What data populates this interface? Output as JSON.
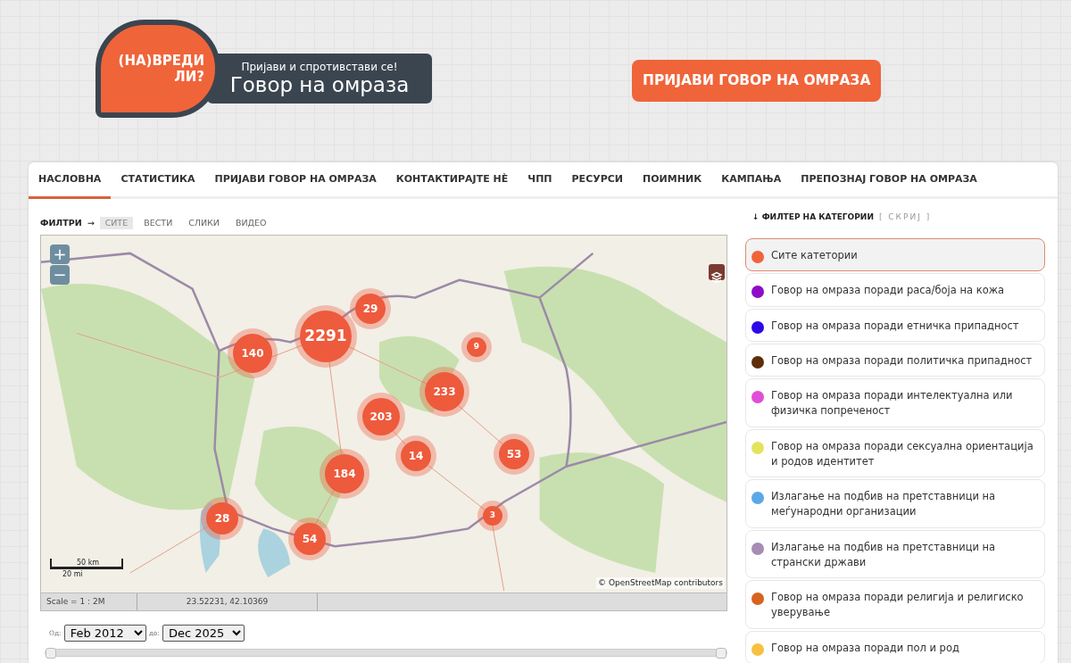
{
  "logo": {
    "line_1": "(НА)ВРЕДИ",
    "line_2": "ЛИ?",
    "tagline": "Пријави и спротивстави се!",
    "title": "Говор на омраза"
  },
  "report_button": "ПРИЈАВИ ГОВОР НА ОМРАЗА",
  "nav": [
    {
      "label": "НАСЛОВНА",
      "selected": true
    },
    {
      "label": "СТАТИСТИКА",
      "selected": false
    },
    {
      "label": "ПРИЈАВИ ГОВОР НА ОМРАЗА",
      "selected": false
    },
    {
      "label": "КОНТАКТИРАЈТЕ НÈ",
      "selected": false
    },
    {
      "label": "ЧПП",
      "selected": false
    },
    {
      "label": "РЕСУРСИ",
      "selected": false
    },
    {
      "label": "ПОИМНИК",
      "selected": false
    },
    {
      "label": "КАМПАЊА",
      "selected": false
    },
    {
      "label": "ПРЕПОЗНАЈ ГОВОР НА ОМРАЗА",
      "selected": false
    }
  ],
  "filters": {
    "label": "ФИЛТРИ",
    "arrow": "→",
    "items": [
      {
        "label": "СИТЕ",
        "selected": true
      },
      {
        "label": "ВЕСТИ",
        "selected": false
      },
      {
        "label": "СЛИКИ",
        "selected": false
      },
      {
        "label": "ВИДЕО",
        "selected": false
      }
    ]
  },
  "map": {
    "zoom_in": "+",
    "zoom_out": "−",
    "clusters": [
      "2291",
      "29",
      "140",
      "9",
      "233",
      "203",
      "14",
      "53",
      "184",
      "28",
      "54",
      "3"
    ],
    "scale_km": "50 km",
    "scale_mi": "20 mi",
    "attribution_prefix": "©",
    "attribution_link": "OpenStreetMap contributors",
    "status_scale": "Scale = 1 : 2M",
    "status_coords": "23.52231, 42.10369"
  },
  "date_range": {
    "from_label": "Од:",
    "from_value": "Feb 2012",
    "to_label": "до:",
    "to_value": "Dec 2025",
    "handles": [
      {
        "level": 0
      },
      {
        "level": 1
      }
    ]
  },
  "category_filter": {
    "arrow": "↓",
    "title": "ФИЛТЕР НА КАТЕГОРИИ",
    "toggle": "[ СКРИЈ ]",
    "items": [
      {
        "label": "Сите катетории",
        "color": "#f0643a",
        "selected": true
      },
      {
        "label": "Говор на омраза поради раса/боја на кожа",
        "color": "#8e0cc8",
        "selected": false
      },
      {
        "label": "Говор на омраза поради етничка припадност",
        "color": "#2e09e8",
        "selected": false
      },
      {
        "label": "Говор на омраза поради политичка припадност",
        "color": "#5e2e0a",
        "selected": false
      },
      {
        "label": "Говор на омраза поради интелектуална или физичка попреченост",
        "color": "#e04ed6",
        "selected": false
      },
      {
        "label": "Говор на омраза поради сексуална ориентација и родов идентитет",
        "color": "#e2e45c",
        "selected": false
      },
      {
        "label": "Излагање на подбив на претставници на меѓународни организации",
        "color": "#5aa8e8",
        "selected": false
      },
      {
        "label": "Излагање на подбив на претставници на странски држави",
        "color": "#a88cb4",
        "selected": false
      },
      {
        "label": "Говор на омраза поради религија и религиско уверување",
        "color": "#d8621e",
        "selected": false
      },
      {
        "label": "Говор на омраза поради пол и род",
        "color": "#f8c040",
        "selected": false
      }
    ]
  }
}
